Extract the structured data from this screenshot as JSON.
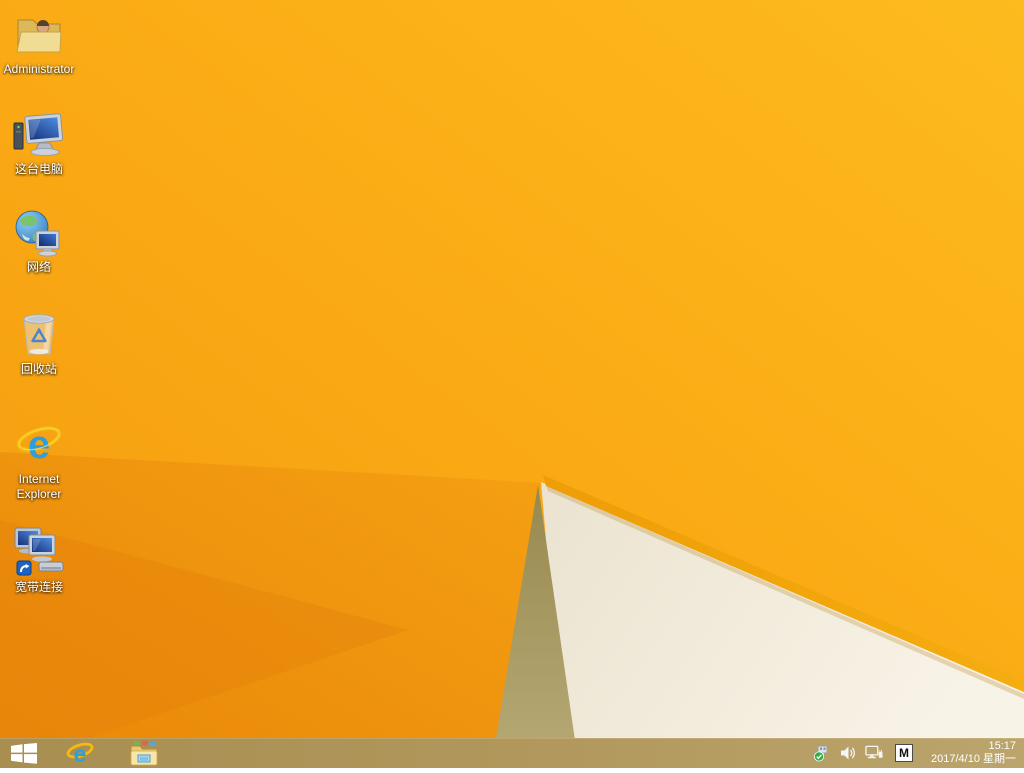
{
  "desktop": {
    "icons": [
      {
        "name": "administrator-folder",
        "icon": "user-folder-icon",
        "label": "Administrator"
      },
      {
        "name": "this-pc",
        "icon": "computer-icon",
        "label": "这台电脑"
      },
      {
        "name": "network",
        "icon": "globe-monitor-icon",
        "label": "网络"
      },
      {
        "name": "recycle-bin",
        "icon": "recycle-bin-icon",
        "label": "回收站"
      },
      {
        "name": "internet-explorer",
        "icon": "ie-icon",
        "label": "Internet Explorer"
      },
      {
        "name": "broadband-connection",
        "icon": "dialup-monitors-icon",
        "label": "宽带连接"
      }
    ]
  },
  "taskbar": {
    "start_button": {
      "icon": "windows-logo-icon"
    },
    "pinned": [
      {
        "name": "internet-explorer",
        "icon": "ie-icon"
      },
      {
        "name": "file-explorer",
        "icon": "folder-icon"
      }
    ],
    "tray": {
      "icons": [
        {
          "name": "safely-remove-hardware-icon"
        },
        {
          "name": "volume-icon"
        },
        {
          "name": "network-status-icon"
        },
        {
          "name": "ime-indicator",
          "label": "M"
        }
      ],
      "clock": {
        "time": "15:17",
        "date": "2017/4/10 星期一"
      }
    }
  },
  "colors": {
    "wallpaper_amber": "#fbae16",
    "wallpaper_amber_bright": "#fdbb1e",
    "wallpaper_orange_dark": "#e88708",
    "wallpaper_cream": "#f4eedf",
    "wallpaper_tan": "#a89a63",
    "wallpaper_gold_edge": "#efa30a",
    "taskbar_background": "#b2985c",
    "text": "#ffffff"
  }
}
